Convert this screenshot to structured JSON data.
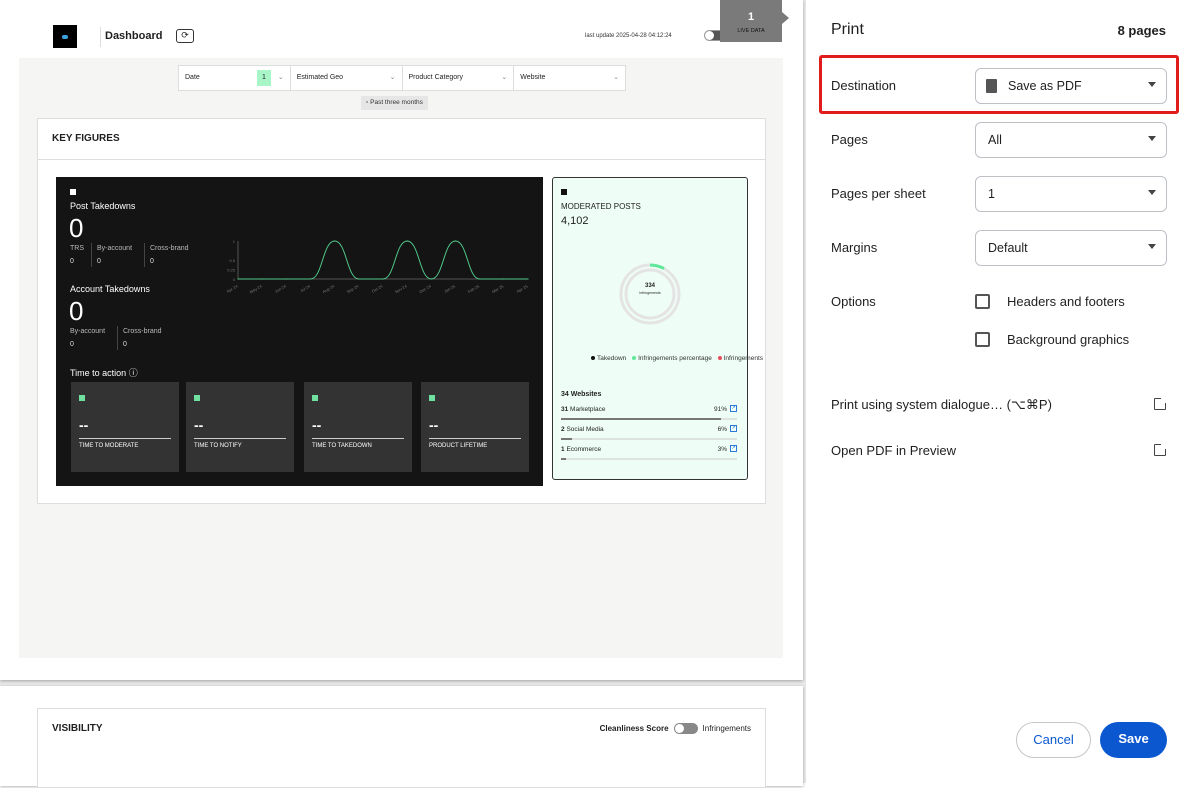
{
  "preview": {
    "header": {
      "title": "Dashboard",
      "last_update": "last update 2025-04-28 04:12:24",
      "live_data": "LIVE DATA",
      "page_number": "1"
    },
    "filters": [
      {
        "label": "Date",
        "badge": "1"
      },
      {
        "label": "Estimated Geo"
      },
      {
        "label": "Product Category"
      },
      {
        "label": "Website"
      }
    ],
    "period": "Past three months",
    "key_figures": {
      "title": "KEY FIGURES",
      "post_takedowns": {
        "label": "Post Takedowns",
        "value": "0",
        "breakdown": [
          {
            "label": "TRS",
            "value": "0"
          },
          {
            "label": "By-account",
            "value": "0"
          },
          {
            "label": "Cross-brand",
            "value": "0"
          }
        ]
      },
      "account_takedowns": {
        "label": "Account Takedowns",
        "value": "0",
        "breakdown": [
          {
            "label": "By-account",
            "value": "0"
          },
          {
            "label": "Cross-brand",
            "value": "0"
          }
        ]
      },
      "time_to_action": {
        "label": "Time to action",
        "tiles": [
          {
            "value": "--",
            "label": "TIME TO MODERATE"
          },
          {
            "value": "--",
            "label": "TIME TO NOTIFY"
          },
          {
            "value": "--",
            "label": "TIME TO TAKEDOWN"
          },
          {
            "value": "--",
            "label": "PRODUCT LIFETIME"
          }
        ]
      },
      "moderated": {
        "label": "MODERATED POSTS",
        "value": "4,102",
        "donut_value": "334",
        "donut_label": "Infringements",
        "donut_fraction": 0.08,
        "legend": [
          {
            "label": "Takedown",
            "color": "#111111"
          },
          {
            "label": "Infringements percentage",
            "color": "#5ee89a"
          },
          {
            "label": "Infringements",
            "color": "#e84b5a"
          }
        ],
        "websites_title": "34 Websites",
        "websites": [
          {
            "count": "31",
            "name": "Marketplace",
            "pct": "91%",
            "fraction": 0.91
          },
          {
            "count": "2",
            "name": "Social Media",
            "pct": "6%",
            "fraction": 0.06
          },
          {
            "count": "1",
            "name": "Ecommerce",
            "pct": "3%",
            "fraction": 0.03
          }
        ]
      }
    },
    "chart_data": {
      "type": "line",
      "x": [
        "Apr 24",
        "May 24",
        "Jun 24",
        "Jul 24",
        "Aug 24",
        "Sep 24",
        "Oct 24",
        "Nov 24",
        "Dec 24",
        "Jan 25",
        "Feb 25",
        "Mar 25",
        "Apr 25"
      ],
      "values": [
        0,
        0,
        0,
        0,
        1,
        0,
        0,
        1,
        0,
        1,
        0,
        0,
        0
      ],
      "y_ticks": [
        "0",
        "0.25",
        "0.5",
        "1"
      ],
      "ylim": [
        0,
        1
      ],
      "color": "#4fc98a"
    },
    "visibility": {
      "title": "VISIBILITY",
      "toggle_left": "Cleanliness Score",
      "toggle_right": "Infringements"
    }
  },
  "print": {
    "title": "Print",
    "pages_count": "8 pages",
    "destination": {
      "label": "Destination",
      "value": "Save as PDF"
    },
    "pages": {
      "label": "Pages",
      "value": "All"
    },
    "pages_per_sheet": {
      "label": "Pages per sheet",
      "value": "1"
    },
    "margins": {
      "label": "Margins",
      "value": "Default"
    },
    "options": {
      "label": "Options",
      "headers_footers": "Headers and footers",
      "background_graphics": "Background graphics"
    },
    "system_dialog": "Print using system dialogue… (⌥⌘P)",
    "open_preview": "Open PDF in Preview",
    "cancel": "Cancel",
    "save": "Save"
  }
}
